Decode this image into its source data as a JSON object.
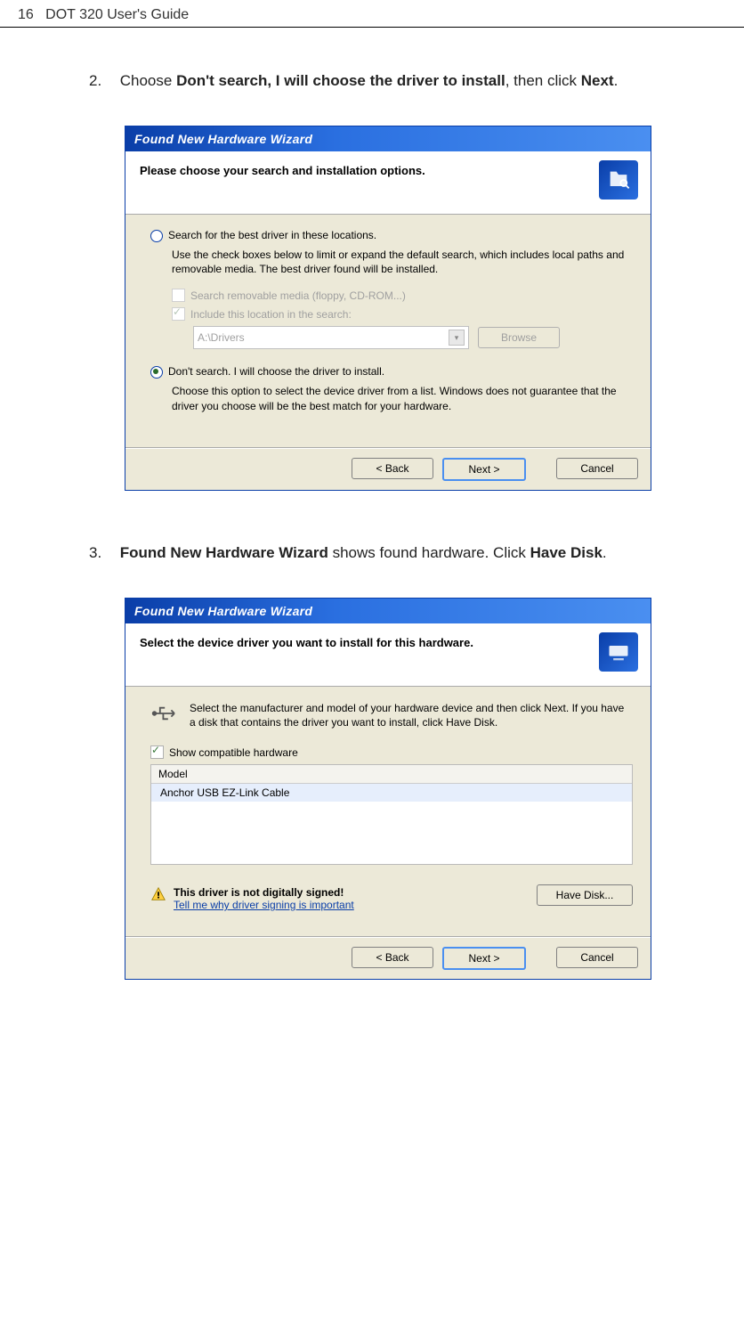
{
  "header": {
    "page_number": "16",
    "title": "DOT 320 User's Guide"
  },
  "step2": {
    "num": "2.",
    "prefix": "Choose ",
    "bold": "Don't search, I will choose the driver to install",
    "mid": ", then click ",
    "bold2": "Next",
    "suffix": "."
  },
  "wiz1": {
    "title": "Found New Hardware Wizard",
    "header": "Please choose your search and installation options.",
    "opt1": "Search for the best driver in these locations.",
    "opt1_desc": "Use the check boxes below to limit or expand the default search, which includes local paths and removable media. The best driver found will be installed.",
    "chk1": "Search removable media (floppy, CD-ROM...)",
    "chk2": "Include this location in the search:",
    "path": "A:\\Drivers",
    "browse": "Browse",
    "opt2": "Don't search. I will choose the driver to install.",
    "opt2_desc": "Choose this option to select the device driver from a list.  Windows does not guarantee that the driver you choose will be the best match for your hardware.",
    "back": "< Back",
    "next": "Next >",
    "cancel": "Cancel"
  },
  "step3": {
    "num": "3.",
    "bold1": "Found New Hardware Wizard",
    "mid": " shows found hardware. Click ",
    "bold2": "Have Disk",
    "suffix": "."
  },
  "wiz2": {
    "title": "Found New Hardware Wizard",
    "header": "Select the device driver you want to install for this hardware.",
    "desc": "Select the manufacturer and model of your hardware device and then click Next. If you have a disk that contains the driver you want to install, click Have Disk.",
    "show_compat": "Show compatible hardware",
    "model_col": "Model",
    "model_val": "Anchor USB EZ-Link Cable",
    "warn": "This driver is not digitally signed!",
    "warn_link": "Tell me why driver signing is important",
    "have_disk": "Have Disk...",
    "back": "< Back",
    "next": "Next >",
    "cancel": "Cancel"
  }
}
